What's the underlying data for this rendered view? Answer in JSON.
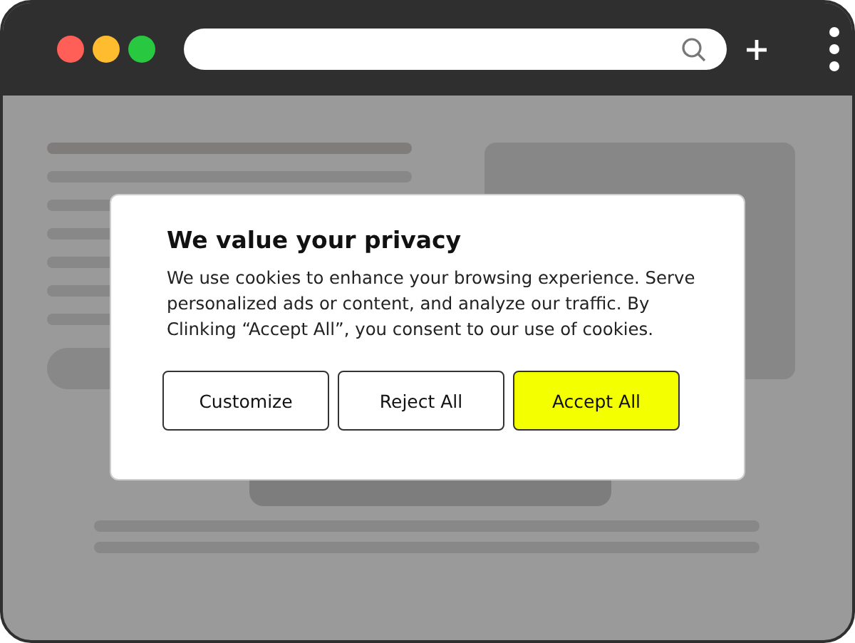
{
  "dialog": {
    "title": "We value your privacy",
    "message": "We use cookies to enhance your browsing experience. Serve personalized ads or content, and analyze our traffic. By Clinking “Accept All”, you consent to our use of cookies.",
    "buttons": [
      {
        "label": "Customize",
        "kind": "secondary"
      },
      {
        "label": "Reject All",
        "kind": "secondary"
      },
      {
        "label": "Accept All",
        "kind": "primary"
      }
    ]
  }
}
